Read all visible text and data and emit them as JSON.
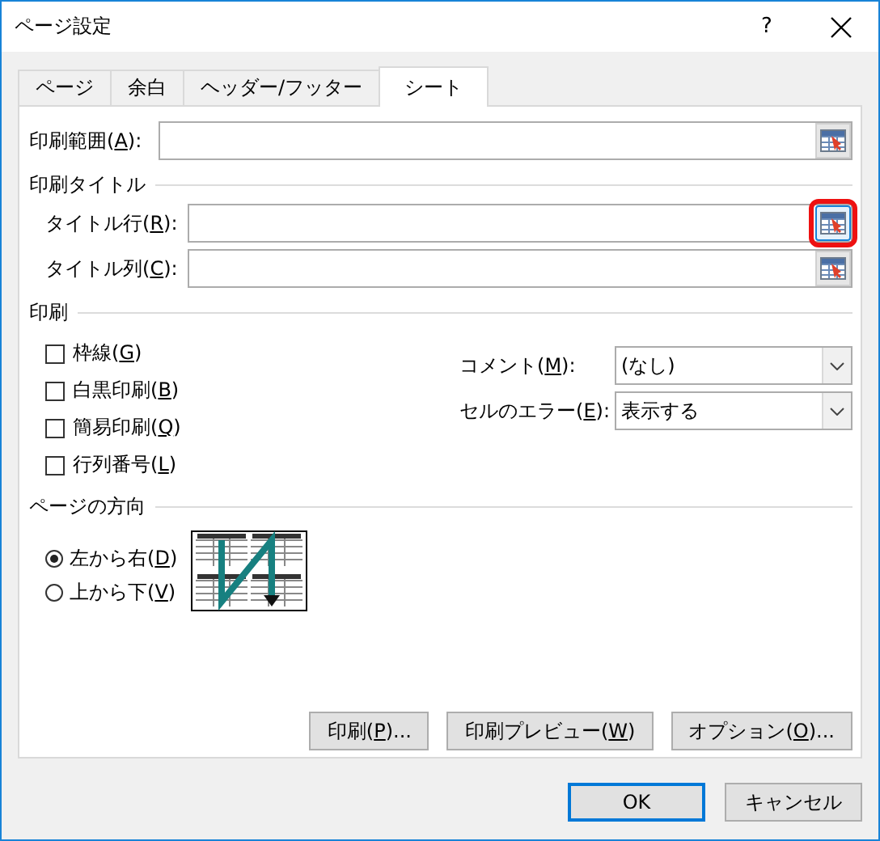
{
  "window": {
    "title": "ページ設定",
    "help": "?"
  },
  "tabs": [
    {
      "label": "ページ",
      "selected": false
    },
    {
      "label": "余白",
      "selected": false
    },
    {
      "label": "ヘッダー/フッター",
      "selected": false
    },
    {
      "label": "シート",
      "selected": true
    }
  ],
  "print_area": {
    "label": {
      "pre": "印刷範囲(",
      "key": "A",
      "post": "):"
    }
  },
  "print_titles": {
    "heading": "印刷タイトル",
    "fields": [
      {
        "label": {
          "pre": "タイトル行(",
          "key": "R",
          "post": "):"
        },
        "highlighted": true
      },
      {
        "label": {
          "pre": "タイトル列(",
          "key": "C",
          "post": "):"
        },
        "highlighted": false
      }
    ]
  },
  "print": {
    "heading": "印刷",
    "checkboxes": [
      {
        "label": {
          "pre": "枠線(",
          "key": "G",
          "post": ")"
        },
        "checked": false
      },
      {
        "label": {
          "pre": "白黒印刷(",
          "key": "B",
          "post": ")"
        },
        "checked": false
      },
      {
        "label": {
          "pre": "簡易印刷(",
          "key": "Q",
          "post": ")"
        },
        "checked": false
      },
      {
        "label": {
          "pre": "行列番号(",
          "key": "L",
          "post": ")"
        },
        "checked": false
      }
    ],
    "dropdowns": [
      {
        "label": {
          "pre": "コメント(",
          "key": "M",
          "post": "):"
        },
        "value": "(なし)"
      },
      {
        "label": {
          "pre": "セルのエラー(",
          "key": "E",
          "post": "):"
        },
        "value": "表示する"
      }
    ]
  },
  "orientation": {
    "heading": "ページの方向",
    "options": [
      {
        "label": {
          "pre": "左から右(",
          "key": "D",
          "post": ")"
        },
        "selected": true
      },
      {
        "label": {
          "pre": "上から下(",
          "key": "V",
          "post": ")"
        },
        "selected": false
      }
    ]
  },
  "buttons": [
    {
      "label": {
        "pre": "印刷(",
        "key": "P",
        "post": ")..."
      }
    },
    {
      "label": {
        "pre": "印刷プレビュー(",
        "key": "W",
        "post": ")"
      }
    },
    {
      "label": {
        "pre": "オプション(",
        "key": "O",
        "post": ")..."
      }
    }
  ],
  "footer_buttons": [
    {
      "label": {
        "pre": "OK"
      },
      "default": true
    },
    {
      "label": {
        "pre": "キャンセル"
      },
      "default": false
    }
  ]
}
